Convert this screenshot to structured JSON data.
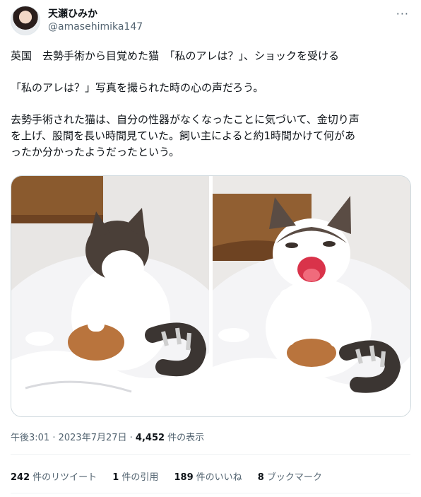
{
  "author": {
    "display_name": "天瀬ひみか",
    "handle": "@amasehimika147"
  },
  "more_icon": "more-horizontal-icon",
  "tweet": {
    "paragraph1": "英国　去勢手術から目覚めた猫　「私のアレは？」、ショックを受ける",
    "paragraph2": "「私のアレは？」写真を撮られた時の心の声だろう。",
    "paragraph3_line1": "去勢手術された猫は、自分の性器がなくなったことに気づいて、金切り声",
    "paragraph3_line2": "を上げ、股間を長い時間見ていた。飼い主によると約1時間かけて何があ",
    "paragraph3_line3": "ったか分かったようだったという。"
  },
  "media": {
    "photos": [
      {
        "subject": "cat-looking-down-photo"
      },
      {
        "subject": "cat-screaming-photo"
      }
    ]
  },
  "meta": {
    "time": "午後3:01",
    "separator": " · ",
    "date": "2023年7月27日",
    "views_count": "4,452",
    "views_label": " 件の表示"
  },
  "stats": [
    {
      "count": "242",
      "label": "件のリツイート"
    },
    {
      "count": "1",
      "label": "件の引用"
    },
    {
      "count": "189",
      "label": "件のいいね"
    },
    {
      "count": "8",
      "label": "ブックマーク"
    }
  ],
  "colors": {
    "text_primary": "#0f1419",
    "text_secondary": "#536471",
    "border": "#cfd9de",
    "divider": "#eff3f4"
  }
}
